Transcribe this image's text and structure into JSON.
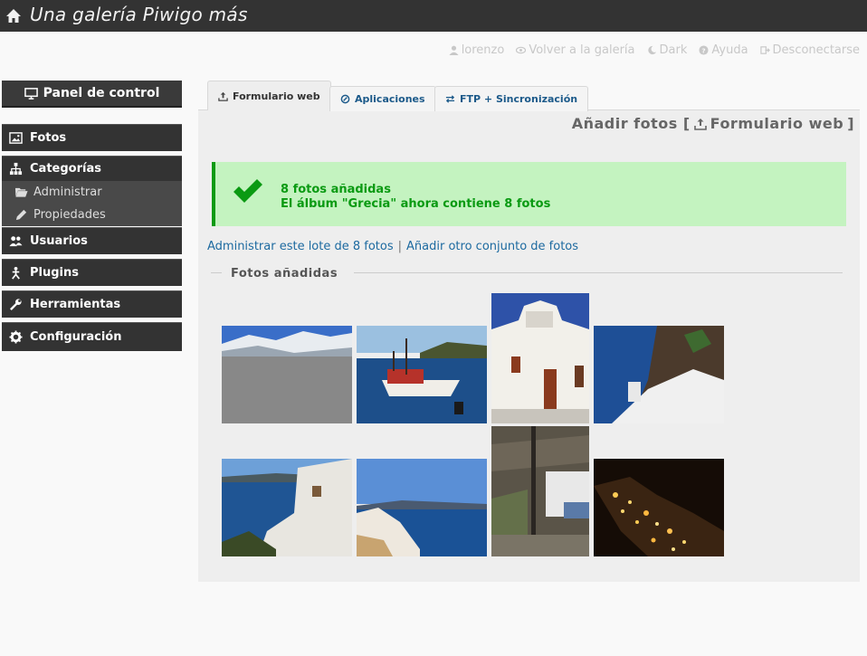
{
  "header": {
    "site_title": "Una galería Piwigo más"
  },
  "user_menu": [
    {
      "label": "lorenzo",
      "icon": "user-icon"
    },
    {
      "label": "Volver a la galería",
      "icon": "eye-icon"
    },
    {
      "label": "Dark",
      "icon": "moon-icon"
    },
    {
      "label": "Ayuda",
      "icon": "help-icon"
    },
    {
      "label": "Desconectarse",
      "icon": "logout-icon"
    }
  ],
  "sidebar": {
    "dashboard_label": "Panel de control",
    "sections": {
      "fotos": "Fotos",
      "categorias": "Categorías",
      "administrar": "Administrar",
      "propiedades": "Propiedades",
      "usuarios": "Usuarios",
      "plugins": "Plugins",
      "herramientas": "Herramientas",
      "configuracion": "Configuración"
    }
  },
  "tabs": {
    "web_form": "Formulario web",
    "apps": "Aplicaciones",
    "ftp": "FTP + Sincronización"
  },
  "page": {
    "heading_prefix": "Añadir fotos [",
    "heading_link": "Formulario web",
    "heading_suffix": "]"
  },
  "success": {
    "line1": "8 fotos añadidas",
    "line2": "El álbum \"Grecia\" ahora contiene 8 fotos"
  },
  "links": {
    "manage_batch": "Administrar este lote de 8 fotos",
    "separator": "|",
    "add_another": "Añadir otro conjunto de fotos"
  },
  "added_photos_legend": "Fotos añadidas",
  "colors": {
    "topbar": "#333333",
    "success_bg": "#c4f3c0",
    "success_text": "#0a9a12",
    "link": "#1d6aa0"
  }
}
